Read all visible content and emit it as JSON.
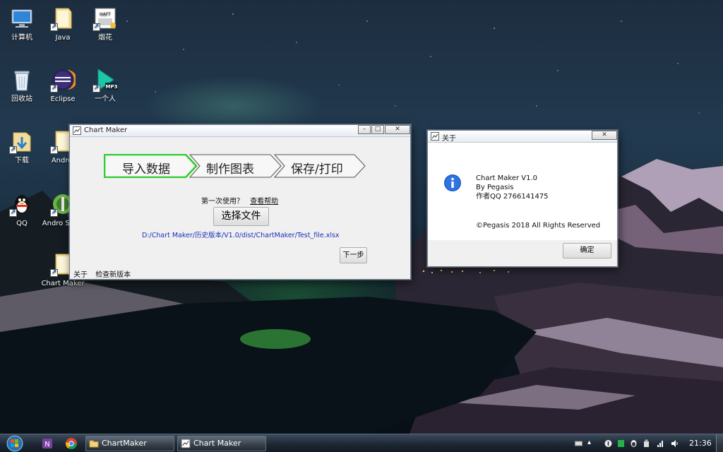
{
  "desktop": {
    "icons": [
      {
        "label": "计算机",
        "icon": "computer-icon"
      },
      {
        "label": "Java",
        "icon": "folder-icon"
      },
      {
        "label": "烟花",
        "icon": "fireworks-app-icon"
      },
      {
        "label": "回收站",
        "icon": "recycle-bin-icon"
      },
      {
        "label": "Eclipse",
        "icon": "eclipse-icon"
      },
      {
        "label": "一个人",
        "icon": "mp3-file-icon",
        "badge": "MP3"
      },
      {
        "label": "下载",
        "icon": "download-folder-icon"
      },
      {
        "label": "Androi",
        "icon": "folder-icon"
      },
      {
        "label": "QQ",
        "icon": "qq-penguin-icon"
      },
      {
        "label": "Andro Studi",
        "icon": "android-studio-icon"
      },
      {
        "label": "Chart Maker",
        "icon": "folder-icon"
      }
    ],
    "fireworks_thumb_text": "HAFT"
  },
  "chart_maker": {
    "title": "Chart Maker",
    "steps": [
      "导入数据",
      "制作图表",
      "保存/打印"
    ],
    "active_step": 0,
    "first_use_text": "第一次使用？",
    "help_link": "查看帮助",
    "select_file_button": "选择文件",
    "file_path": "D:/Chart Maker/历史版本/V1.0/dist/ChartMaker/Test_file.xlsx",
    "next_button": "下一步",
    "footer_links": [
      "关于",
      "检查新版本"
    ],
    "accent_color": "#2ecc2e"
  },
  "about_dialog": {
    "title": "关于",
    "lines": [
      "Chart Maker V1.0",
      "By Pegasis",
      "作者QQ 2766141475"
    ],
    "copyright": "©Pegasis 2018   All Rights Reserved",
    "ok_button": "确定"
  },
  "taskbar": {
    "tasks": [
      {
        "label": "ChartMaker",
        "icon": "folder-icon"
      },
      {
        "label": "Chart Maker",
        "icon": "chart-app-icon"
      }
    ],
    "clock": "21:36"
  }
}
